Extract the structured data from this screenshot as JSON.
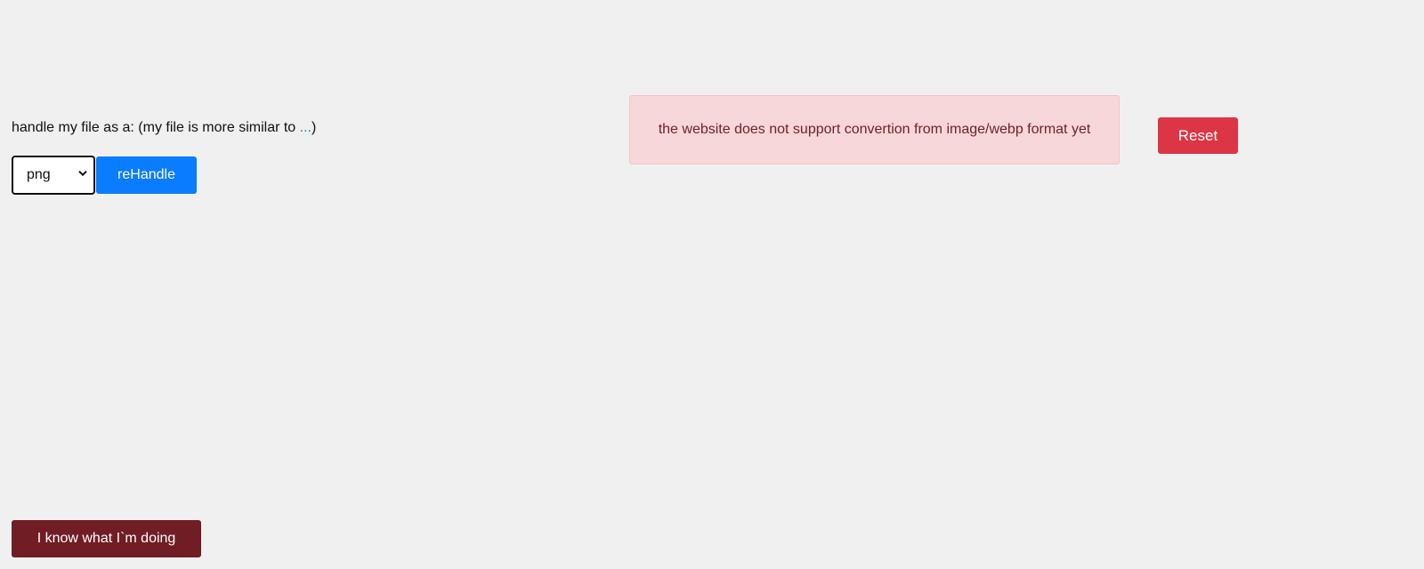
{
  "handle": {
    "label": "handle my file as a: (my file is more similar to ",
    "label_dots": "...",
    "label_end": ")",
    "select": {
      "selected": "png",
      "icon": "chevron-down-icon"
    },
    "rehandle_label": "reHandle"
  },
  "alert": {
    "message": "the website does not support convertion from image/webp format yet"
  },
  "reset_label": "Reset",
  "override_label": "I know what I`m doing",
  "colors": {
    "background": "#f0f0f0",
    "primary": "#0a7cff",
    "danger": "#dc3545",
    "alert_bg": "#f7d7da",
    "alert_text": "#6e2329",
    "dark_red": "#701d25"
  }
}
